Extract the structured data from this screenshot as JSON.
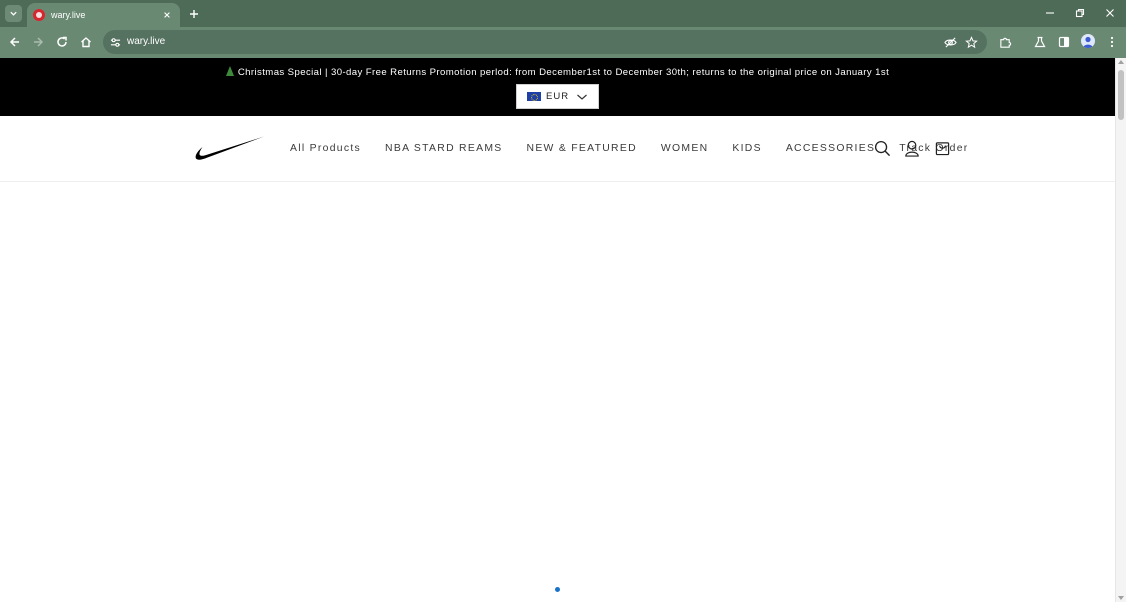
{
  "browser": {
    "tab": {
      "title": "wary.live"
    },
    "address_bar": {
      "url": "wary.live"
    }
  },
  "announcement": {
    "text": "Christmas Special | 30-day Free Returns Promotion perlod: from December1st to December 30th; returns to the original price on January 1st"
  },
  "currency": {
    "selected": "EUR"
  },
  "nav": {
    "items": [
      {
        "label": "All Products"
      },
      {
        "label": "NBA STARD REAMS"
      },
      {
        "label": "NEW & FEATURED"
      },
      {
        "label": "WOMEN"
      },
      {
        "label": "KIDS"
      },
      {
        "label": "ACCESSORIES"
      },
      {
        "label": "Track Order"
      }
    ]
  },
  "colors": {
    "tabstrip": "#4e6b57",
    "toolbar": "#6a8973",
    "announcement_bg": "#000000",
    "slider_dot": "#1a73c8"
  },
  "icons": {
    "header": [
      "search-icon",
      "account-icon",
      "cart-icon"
    ]
  }
}
